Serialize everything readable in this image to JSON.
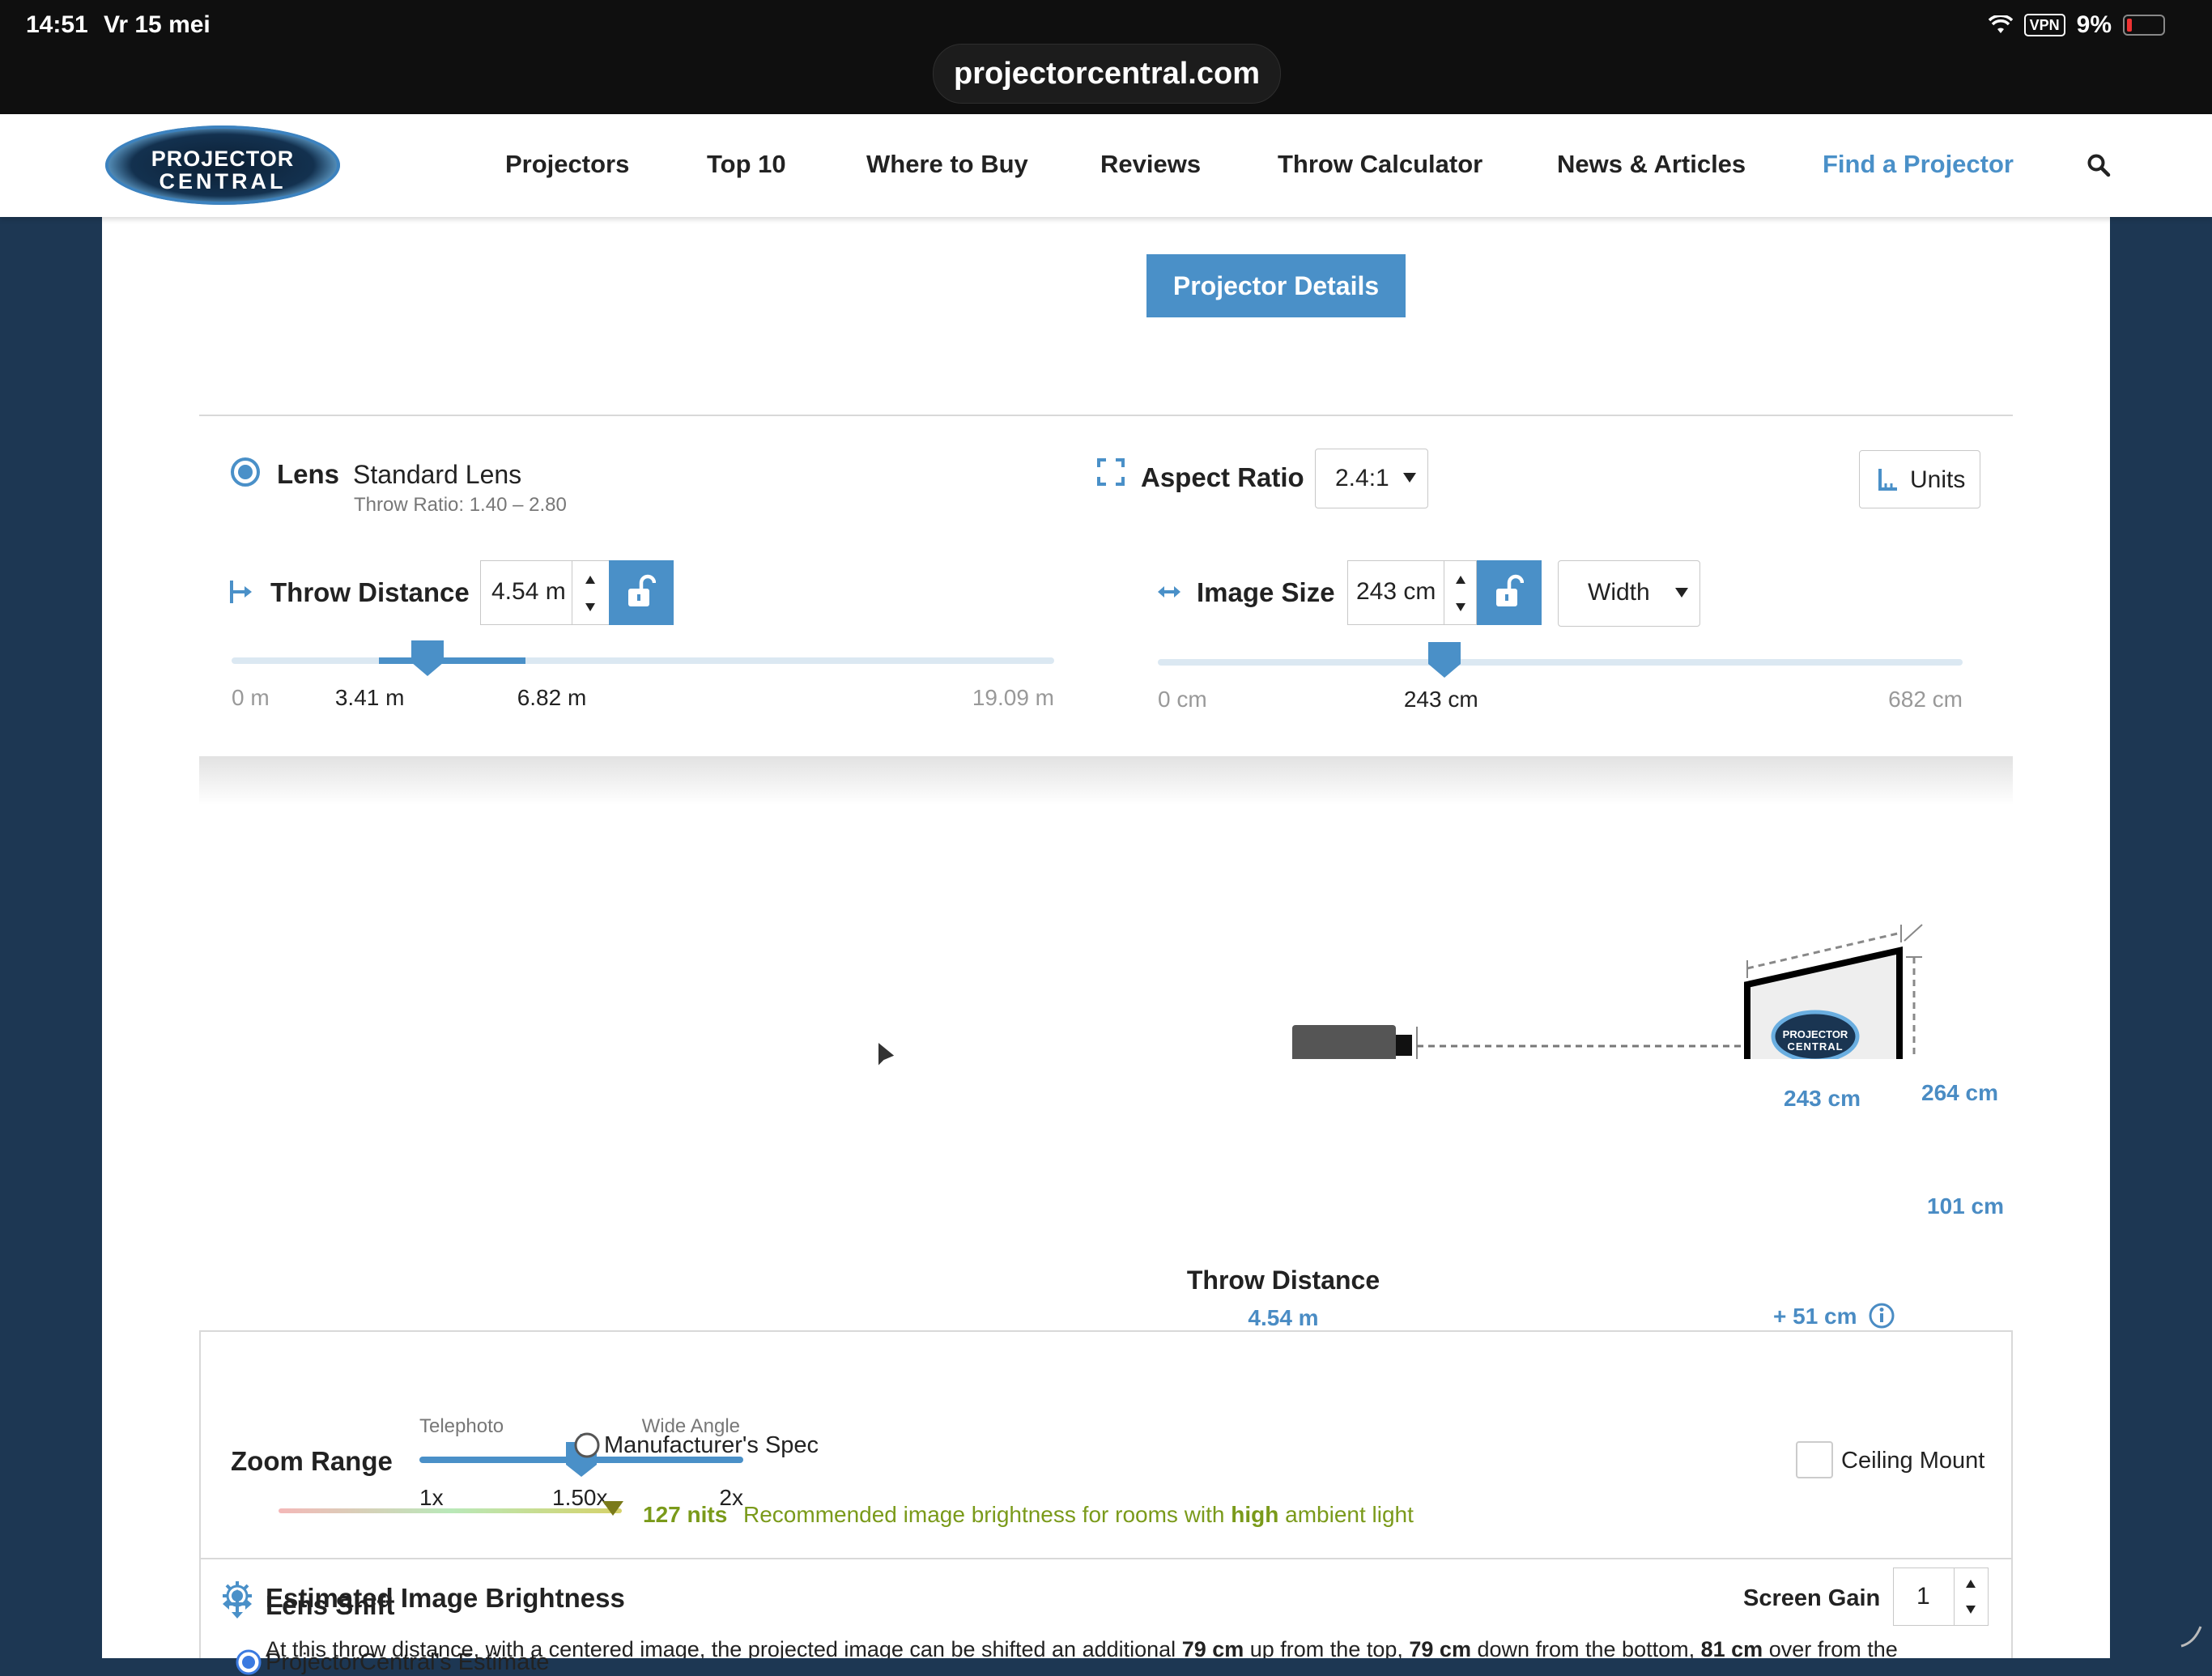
{
  "status": {
    "time": "14:51",
    "date": "Vr 15 mei",
    "vpn": "VPN",
    "battery": "9%"
  },
  "browser": {
    "url": "projectorcentral.com"
  },
  "nav": {
    "logo_line1": "PROJECTOR",
    "logo_line2": "CENTRAL",
    "items": [
      "Projectors",
      "Top 10",
      "Where to Buy",
      "Reviews",
      "Throw Calculator",
      "News & Articles",
      "Find a Projector"
    ]
  },
  "details_button": "Projector Details",
  "lens": {
    "label": "Lens",
    "value": "Standard Lens",
    "throw_ratio": "Throw Ratio: 1.40 – 2.80"
  },
  "aspect": {
    "label": "Aspect Ratio",
    "value": "2.4:1"
  },
  "units_button": "Units",
  "throw": {
    "label": "Throw Distance",
    "value": "4.54 m",
    "min": "0 m",
    "range_low": "3.41 m",
    "range_high": "6.82 m",
    "max": "19.09 m",
    "fraction": 0.238,
    "range_low_fraction": 0.179,
    "range_high_fraction": 0.357
  },
  "image_size": {
    "label": "Image Size",
    "value": "243 cm",
    "dimension": "Width",
    "min": "0 cm",
    "current": "243 cm",
    "max": "682 cm",
    "fraction": 0.356
  },
  "diagram": {
    "throw_label": "Throw Distance",
    "throw_value": "4.54 m",
    "width": "243 cm",
    "diagonal": "264 cm",
    "height": "101 cm",
    "offset": "+ 51 cm",
    "screen_logo_line1": "PROJECTOR",
    "screen_logo_line2": "CENTRAL"
  },
  "zoom": {
    "label": "Zoom Range",
    "telephoto": "Telephoto",
    "wide": "Wide Angle",
    "min": "1x",
    "value": "1.50x",
    "max": "2x",
    "fraction": 0.5
  },
  "ceiling_mount": {
    "label": "Ceiling Mount",
    "checked": false
  },
  "brightness": {
    "title": "Estimated Image Brightness",
    "screen_gain_label": "Screen Gain",
    "screen_gain": "1",
    "option1": "ProjectorCentral's Estimate",
    "option2": "Manufacturer's Spec",
    "nits": "127 nits",
    "rec_prefix": "Recommended image brightness for rooms with",
    "rec_level": "high",
    "rec_suffix": "ambient light"
  },
  "lens_shift": {
    "title": "Lens Shift",
    "text1": "At this throw distance, with a centered image, the projected image can be shifted an additional",
    "v1": "79 cm",
    "text2": "up from the top,",
    "v2": "79 cm",
    "text3": "down from the bottom,",
    "v3": "81 cm",
    "text4": "over from the"
  },
  "colors": {
    "accent": "#4a90c8",
    "dark_bg": "#1d3753",
    "recommend": "#7a9a1a"
  }
}
